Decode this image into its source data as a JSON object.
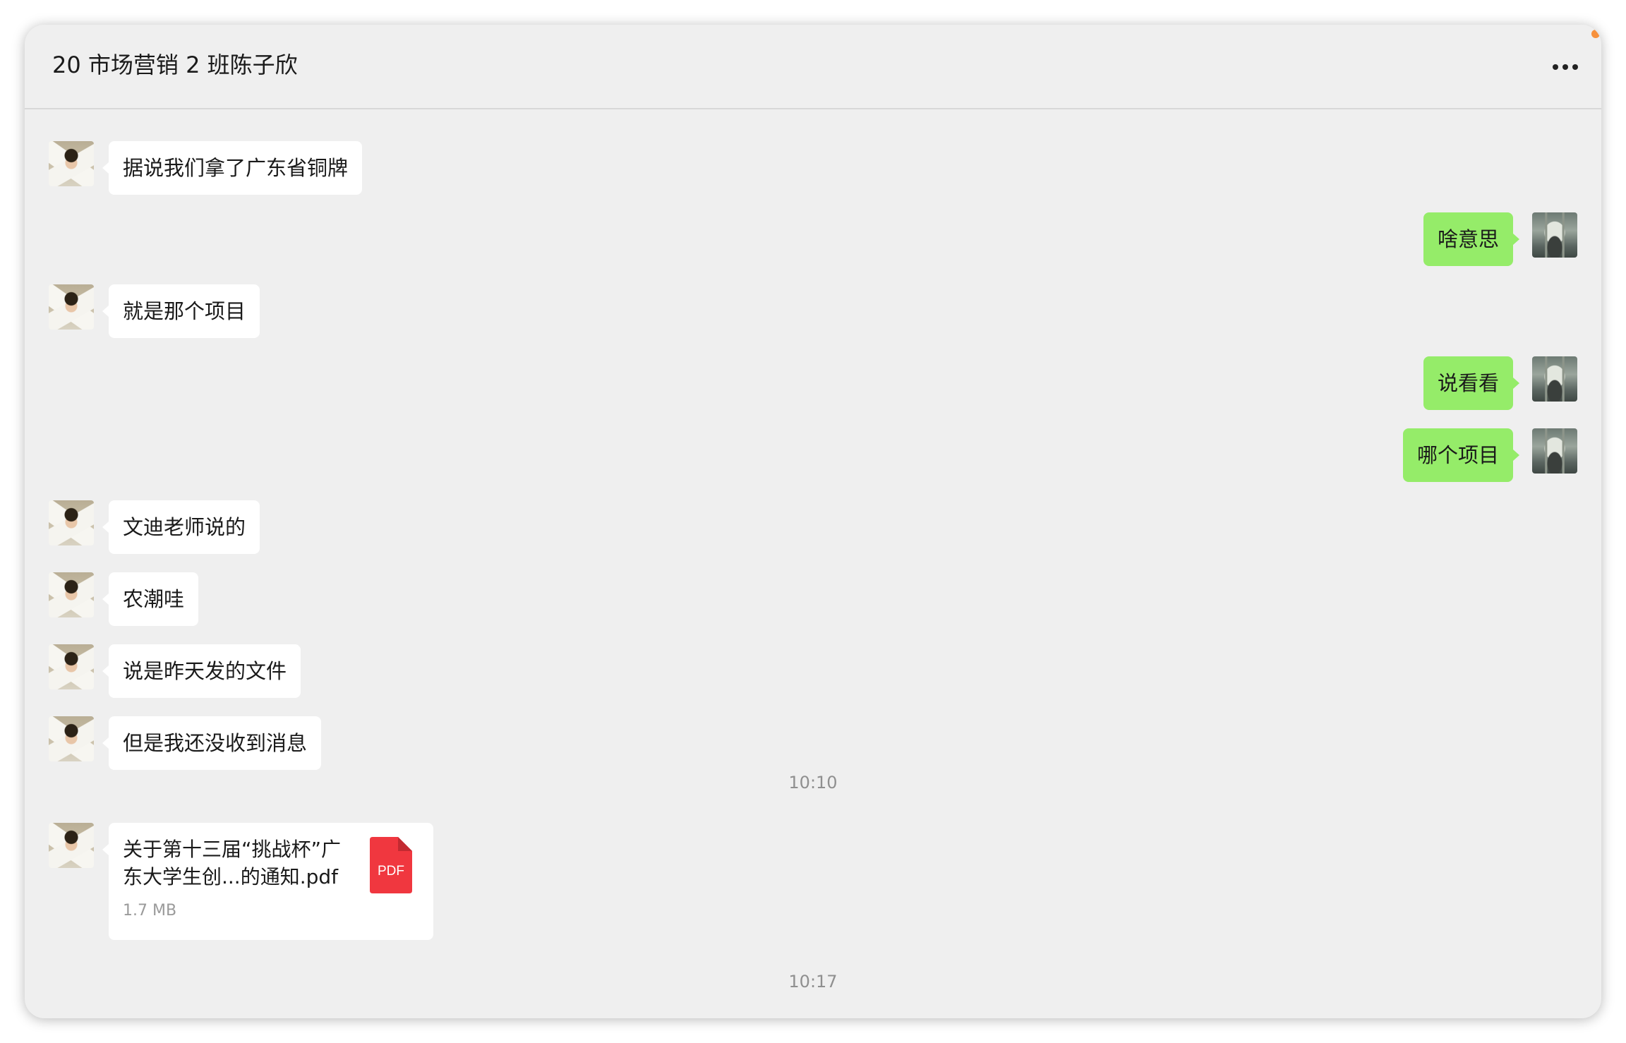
{
  "header": {
    "title": "20 市场营销 2 班陈子欣",
    "more_icon": "more-horizontal-icon",
    "notification_color": "#f7913d"
  },
  "colors": {
    "outgoing_bubble": "#95ec69",
    "incoming_bubble": "#ffffff",
    "background": "#efefef",
    "pdf_red": "#f0373f"
  },
  "messages": [
    {
      "side": "left",
      "text": "据说我们拿了广东省铜牌"
    },
    {
      "side": "right",
      "text": "啥意思"
    },
    {
      "side": "left",
      "text": "就是那个项目"
    },
    {
      "side": "right",
      "text": "说看看"
    },
    {
      "side": "right",
      "text": "哪个项目"
    },
    {
      "side": "left",
      "text": "文迪老师说的"
    },
    {
      "side": "left",
      "text": "农潮哇"
    },
    {
      "side": "left",
      "text": "说是昨天发的文件"
    },
    {
      "side": "left",
      "text": "但是我还没收到消息"
    }
  ],
  "timestamps": [
    "10:10",
    "10:17"
  ],
  "file": {
    "name": "关于第十三届“挑战杯”广东大学生创...的通知.pdf",
    "size": "1.7 MB",
    "icon": "pdf-file-icon",
    "icon_label": "PDF"
  }
}
